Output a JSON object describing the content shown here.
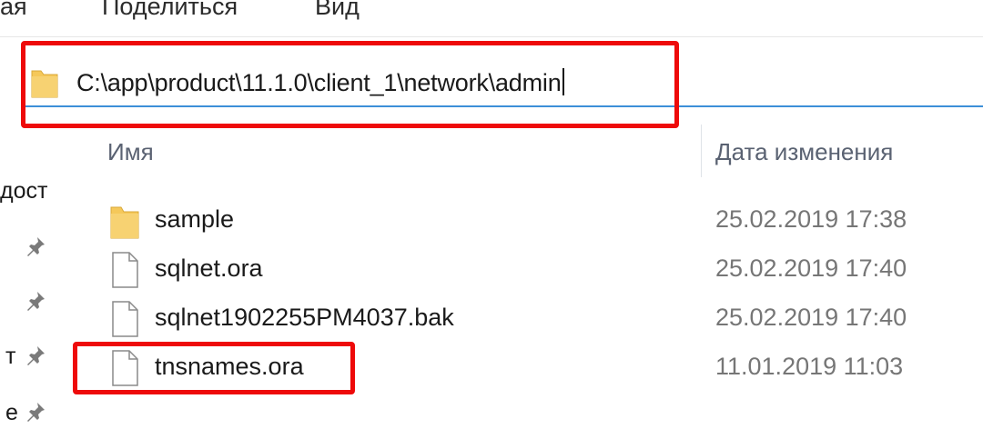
{
  "ribbon": {
    "tabs": [
      "ая",
      "Поделиться",
      "Вид"
    ]
  },
  "address_bar": {
    "path": "C:\\app\\product\\11.1.0\\client_1\\network\\admin",
    "icon": "folder-icon"
  },
  "left_nav": {
    "items": [
      "дост",
      "",
      "",
      "т",
      "е"
    ],
    "pin_icon": "pin-icon"
  },
  "file_list": {
    "columns": {
      "name": "Имя",
      "date_modified": "Дата изменения"
    },
    "rows": [
      {
        "name": "sample",
        "date": "25.02.2019 17:38",
        "icon": "folder-icon"
      },
      {
        "name": "sqlnet.ora",
        "date": "25.02.2019 17:40",
        "icon": "file-icon"
      },
      {
        "name": "sqlnet1902255PM4037.bak",
        "date": "25.02.2019 17:40",
        "icon": "file-icon"
      },
      {
        "name": "tnsnames.ora",
        "date": "11.01.2019 11:03",
        "icon": "file-icon"
      }
    ]
  },
  "colors": {
    "highlight": "#ee0a0a",
    "address_underline": "#3c8fd8",
    "folder": "#f5c85a",
    "date_text": "#767676"
  }
}
